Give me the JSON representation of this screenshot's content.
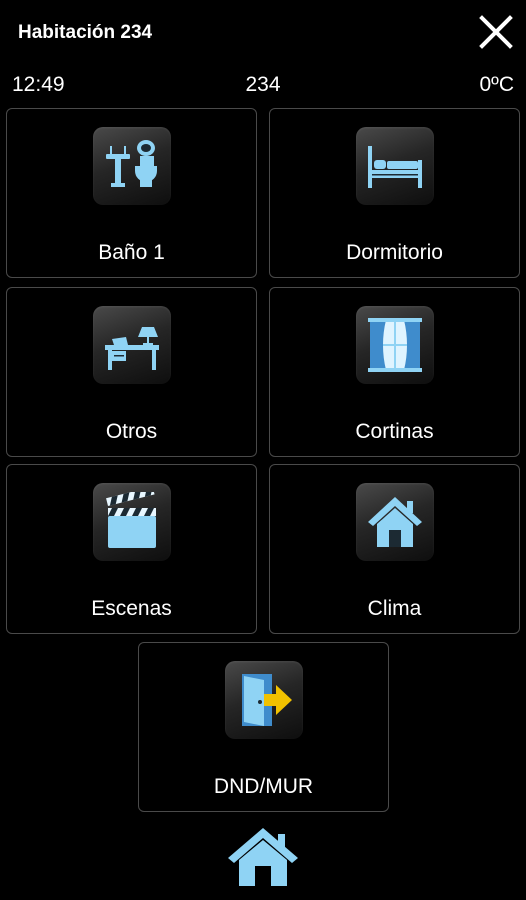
{
  "header": {
    "title": "Habitación 234",
    "close_icon": "close-icon"
  },
  "status": {
    "time": "12:49",
    "room": "234",
    "temperature": "0ºC"
  },
  "tiles": [
    {
      "label": "Baño 1",
      "icon": "bathroom-icon"
    },
    {
      "label": "Dormitorio",
      "icon": "bed-icon"
    },
    {
      "label": "Otros",
      "icon": "desk-lamp-icon"
    },
    {
      "label": "Cortinas",
      "icon": "curtains-icon"
    },
    {
      "label": "Escenas",
      "icon": "clapperboard-icon"
    },
    {
      "label": "Clima",
      "icon": "house-icon"
    },
    {
      "label": "DND/MUR",
      "icon": "door-exit-icon"
    }
  ],
  "footer": {
    "icon": "home-icon"
  },
  "colors": {
    "background": "#000000",
    "icon_blue": "#8fd3f4",
    "arrow_yellow": "#f2c200",
    "tile_border": "#4a4a4a"
  }
}
